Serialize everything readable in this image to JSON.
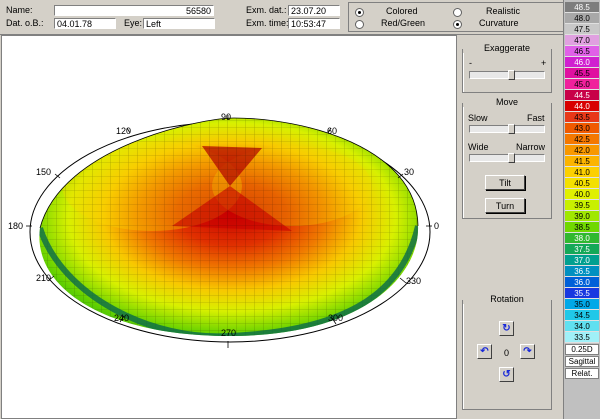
{
  "header": {
    "name_label": "Name:",
    "name_value": "56580",
    "dob_label": "Dat. o.B.:",
    "dob_value": "04.01.78",
    "eye_label": "Eye:",
    "eye_value": "Left",
    "exam_date_label": "Exm. dat.:",
    "exam_date_value": "23.07.20",
    "exam_time_label": "Exm. time:",
    "exam_time_value": "10:53:47"
  },
  "display_mode": {
    "options": [
      {
        "label": "Colored",
        "selected": true
      },
      {
        "label": "Realistic",
        "selected": false
      },
      {
        "label": "Red/Green",
        "selected": false
      },
      {
        "label": "Curvature",
        "selected": true
      }
    ]
  },
  "plot": {
    "angle_labels": [
      "0",
      "30",
      "60",
      "90",
      "120",
      "150",
      "180",
      "210",
      "240",
      "270",
      "300",
      "330"
    ]
  },
  "controls": {
    "exaggerate": {
      "title": "Exaggerate",
      "minus": "-",
      "plus": "+",
      "level": 0.55
    },
    "move": {
      "title": "Move",
      "slow": "Slow",
      "fast": "Fast",
      "speed_level": 0.55,
      "wide": "Wide",
      "narrow": "Narrow",
      "width_level": 0.55,
      "tilt_button": "Tilt",
      "turn_button": "Turn"
    },
    "rotation": {
      "title": "Rotation",
      "value": "0"
    }
  },
  "scale": {
    "values": [
      "48.5",
      "48.0",
      "47.5",
      "47.0",
      "46.5",
      "46.0",
      "45.5",
      "45.0",
      "44.5",
      "44.0",
      "43.5",
      "43.0",
      "42.5",
      "42.0",
      "41.5",
      "41.0",
      "40.5",
      "40.0",
      "39.5",
      "39.0",
      "38.5",
      "38.0",
      "37.5",
      "37.0",
      "36.5",
      "36.0",
      "35.5",
      "35.0",
      "34.5",
      "34.0",
      "33.5"
    ],
    "colors": [
      "#7d7d7d",
      "#a8a8a8",
      "#c8c8c8",
      "#e0a0e0",
      "#e060e8",
      "#d020d0",
      "#e010a0",
      "#f0209c",
      "#c80048",
      "#d80000",
      "#e83818",
      "#f05a00",
      "#f47800",
      "#f89800",
      "#fcb400",
      "#fcd000",
      "#f4e000",
      "#e0f000",
      "#c8f000",
      "#a0e800",
      "#70d800",
      "#30b830",
      "#14a858",
      "#00a090",
      "#0090c0",
      "#0060d8",
      "#1838e0",
      "#00a8e8",
      "#20c8e8",
      "#60e0f0",
      "#a0f0f8"
    ],
    "step": "0.25D",
    "mode": "Sagittal",
    "ref": "Relat."
  }
}
